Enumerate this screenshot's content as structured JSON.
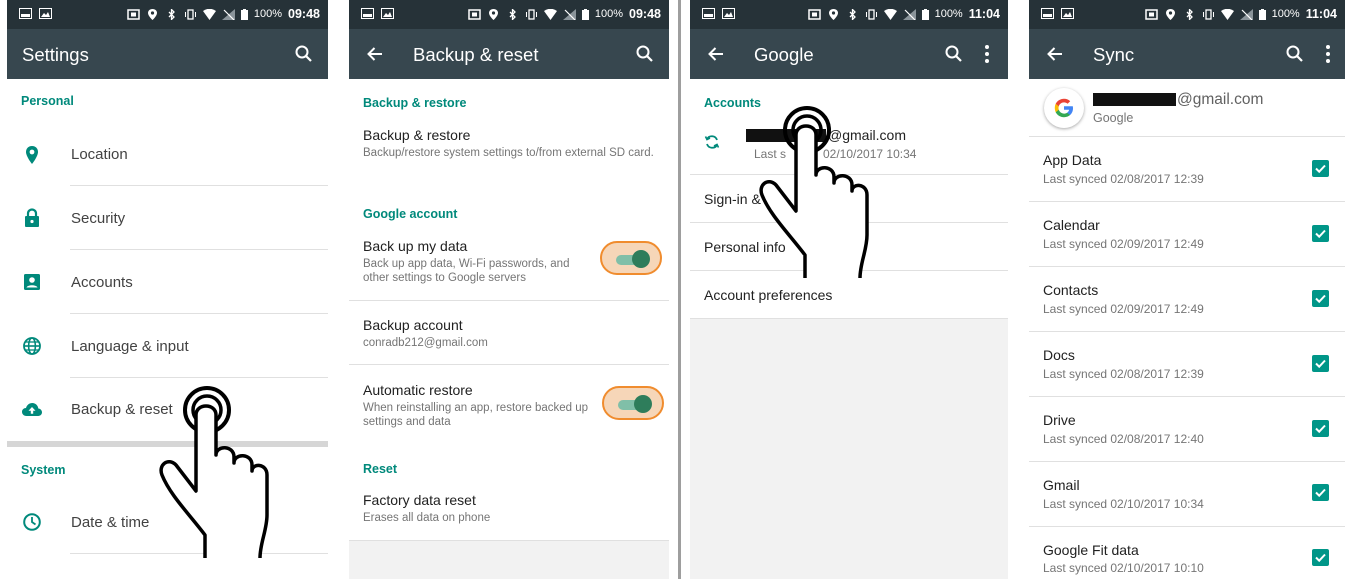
{
  "status_bars": [
    {
      "battery": "100%",
      "time": "09:48"
    },
    {
      "battery": "100%",
      "time": "09:48"
    },
    {
      "battery": "100%",
      "time": "11:04"
    },
    {
      "battery": "100%",
      "time": "11:04"
    }
  ],
  "settings": {
    "title": "Settings",
    "personal_header": "Personal",
    "items": [
      "Location",
      "Security",
      "Accounts",
      "Language & input",
      "Backup & reset"
    ],
    "system_header": "System",
    "system_items": [
      "Date & time"
    ],
    "icons": [
      "location-icon",
      "lock-icon",
      "account-box-icon",
      "globe-icon",
      "cloud-upload-icon",
      "clock-icon"
    ]
  },
  "backup": {
    "title": "Backup & reset",
    "sections": {
      "backup_restore": "Backup & restore",
      "google_account": "Google account",
      "reset": "Reset"
    },
    "backup_restore_item": {
      "title": "Backup & restore",
      "sub": "Backup/restore system settings to/from external SD card."
    },
    "backup_data": {
      "title": "Back up my data",
      "sub": "Back up app data, Wi-Fi passwords, and other settings to Google servers",
      "enabled": true
    },
    "backup_account": {
      "title": "Backup account",
      "sub": "conradb212@gmail.com"
    },
    "auto_restore": {
      "title": "Automatic restore",
      "sub": "When reinstalling an app, restore backed up settings and data",
      "enabled": true
    },
    "factory": {
      "title": "Factory data reset",
      "sub": "Erases all data on phone"
    }
  },
  "google": {
    "title": "Google",
    "accounts_header": "Accounts",
    "account_email": "@gmail.com",
    "account_sub_prefix": "Last s",
    "account_sub_suffix": "02/10/2017 10:34",
    "items": [
      "Sign-in &",
      "Personal info",
      "Account preferences"
    ]
  },
  "sync": {
    "title": "Sync",
    "account_email": "@gmail.com",
    "account_provider": "Google",
    "items": [
      {
        "title": "App Data",
        "sub": "Last synced 02/08/2017 12:39",
        "checked": true
      },
      {
        "title": "Calendar",
        "sub": "Last synced 02/09/2017 12:49",
        "checked": true
      },
      {
        "title": "Contacts",
        "sub": "Last synced 02/09/2017 12:49",
        "checked": true
      },
      {
        "title": "Docs",
        "sub": "Last synced 02/08/2017 12:39",
        "checked": true
      },
      {
        "title": "Drive",
        "sub": "Last synced 02/08/2017 12:40",
        "checked": true
      },
      {
        "title": "Gmail",
        "sub": "Last synced 02/10/2017 10:34",
        "checked": true
      },
      {
        "title": "Google Fit data",
        "sub": "Last synced 02/10/2017 10:10",
        "checked": true
      }
    ]
  },
  "colors": {
    "status_bar": "#263238",
    "app_bar": "#37474f",
    "accent": "#00897b",
    "toggle_highlight": "#f08c2e"
  }
}
